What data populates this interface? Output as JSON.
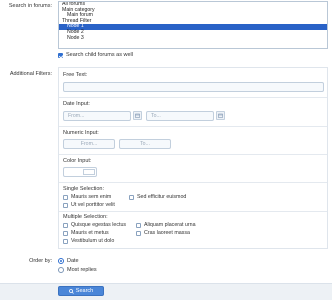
{
  "search_in_forums": {
    "label": "Search in forums:",
    "options": [
      "All forums",
      "Main category",
      "Main forum",
      "Thread Filter",
      "Node 1",
      "Node 2",
      "Node 3"
    ],
    "selected": "Node 1",
    "child_forums_label": "Search child forums as well",
    "child_forums_checked": true
  },
  "additional_filters": {
    "label": "Additional Filters:",
    "free_text": {
      "label": "Free Text:",
      "value": ""
    },
    "date_input": {
      "label": "Date Input:",
      "from_placeholder": "From...",
      "to_placeholder": "To..."
    },
    "numeric_input": {
      "label": "Numeric Input:",
      "from_placeholder": "From...",
      "to_placeholder": "To..."
    },
    "color_input": {
      "label": "Color Input:"
    },
    "single_selection": {
      "label": "Single Selection:",
      "options": [
        "Mauris sem enim",
        "Sed efficitur euismod",
        "Ut vel porttitor velit"
      ]
    },
    "multiple_selection": {
      "label": "Multiple Selection:",
      "options": [
        "Quisque egestas lectus",
        "Aliquam placerat urna",
        "Mauris et metus",
        "Cras laoreet massa",
        "Vestibulum ut dolo"
      ]
    }
  },
  "order_by": {
    "label": "Order by:",
    "options": [
      "Date",
      "Most replies"
    ],
    "selected": "Date"
  },
  "search_button": {
    "label": "Search",
    "icon": "search-icon"
  },
  "colors": {
    "accent": "#2f6fd0",
    "selection": "#2962c7",
    "button": "#4a86d8"
  }
}
